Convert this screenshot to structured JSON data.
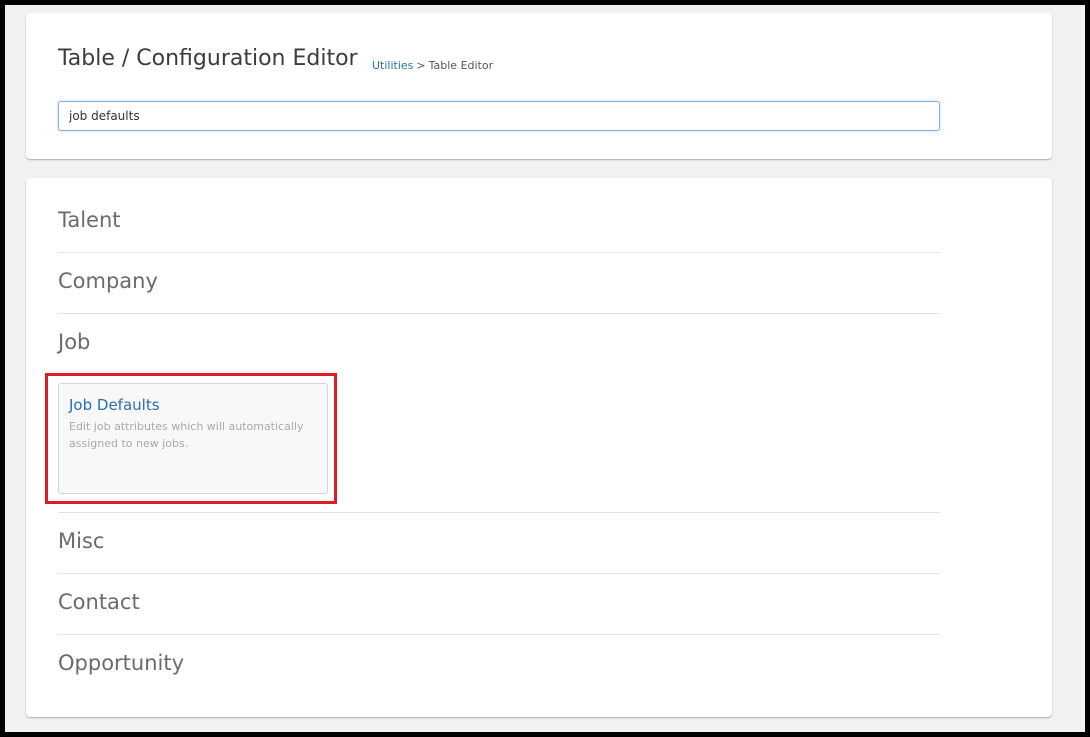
{
  "header": {
    "title": "Table / Configuration Editor",
    "breadcrumb": {
      "parent": "Utilities",
      "separator": ">",
      "current": "Table Editor"
    }
  },
  "search": {
    "value": "job defaults"
  },
  "sections": [
    {
      "label": "Talent"
    },
    {
      "label": "Company"
    },
    {
      "label": "Job"
    },
    {
      "label": "Misc"
    },
    {
      "label": "Contact"
    },
    {
      "label": "Opportunity"
    }
  ],
  "job_items": [
    {
      "title": "Job Defaults",
      "description": "Edit job attributes which will automatically assigned to new jobs."
    }
  ],
  "colors": {
    "accent": "#2a6fb0",
    "highlight": "#e01a24"
  }
}
